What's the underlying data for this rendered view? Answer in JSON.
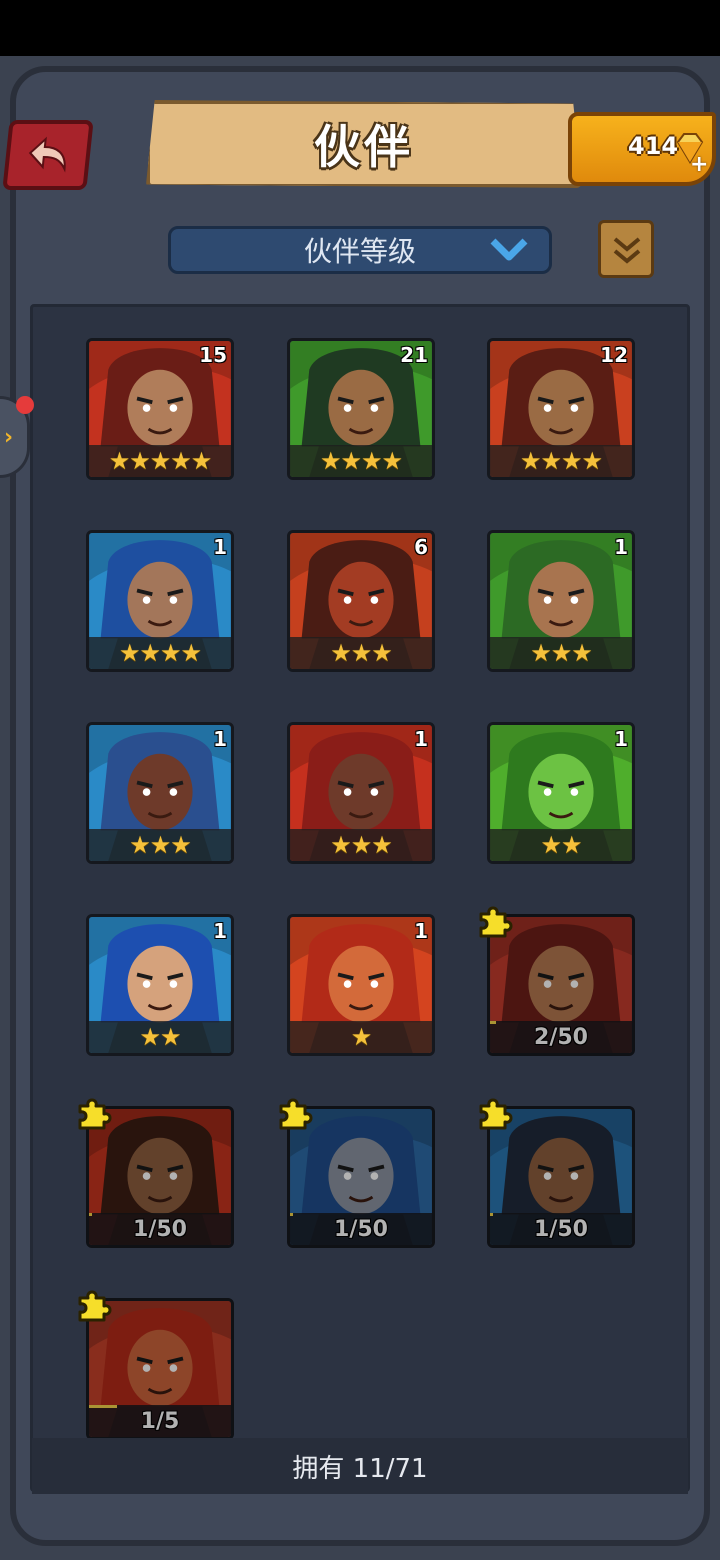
{
  "header": {
    "title": "伙伴",
    "gems": "414"
  },
  "filter": {
    "label": "伙伴等级"
  },
  "partners": [
    {
      "count": "15",
      "stars": "★★★★★",
      "bg": "#c3321f",
      "face": "#b07d5a",
      "hair": "#6a1d16"
    },
    {
      "count": "21",
      "stars": "★★★★",
      "bg": "#3f9a2b",
      "face": "#9a6b44",
      "hair": "#1f3a22"
    },
    {
      "count": "12",
      "stars": "★★★★",
      "bg": "#c9401f",
      "face": "#9a6b44",
      "hair": "#5a1d14"
    },
    {
      "count": "1",
      "stars": "★★★★",
      "bg": "#2a8ac7",
      "face": "#a3765a",
      "hair": "#1e4fa0"
    },
    {
      "count": "6",
      "stars": "★★★",
      "bg": "#c5401e",
      "face": "#a33c23",
      "hair": "#4a1c14"
    },
    {
      "count": "1",
      "stars": "★★★",
      "bg": "#3f9a2b",
      "face": "#a8744f",
      "hair": "#2c6a24"
    },
    {
      "count": "1",
      "stars": "★★★",
      "bg": "#2a8ac7",
      "face": "#6e3a2a",
      "hair": "#2a4f8f"
    },
    {
      "count": "1",
      "stars": "★★★",
      "bg": "#c5301e",
      "face": "#6e3a2a",
      "hair": "#8a1d18"
    },
    {
      "count": "1",
      "stars": "★★",
      "bg": "#4fae2c",
      "face": "#6cc243",
      "hair": "#2e7a1e"
    },
    {
      "count": "1",
      "stars": "★★",
      "bg": "#2a8ac7",
      "face": "#d5a27c",
      "hair": "#1d4fb0"
    },
    {
      "count": "1",
      "stars": "★",
      "bg": "#d4441f",
      "face": "#d36a3a",
      "hair": "#b22a18"
    }
  ],
  "fragments": [
    {
      "progress": "2/50",
      "fill": 0.04,
      "bg": "#c13a2c",
      "face": "#b2774f",
      "hair": "#6d1e18"
    },
    {
      "progress": "1/50",
      "fill": 0.02,
      "bg": "#c4331e",
      "face": "#8c5d3d",
      "hair": "#3a1c12"
    },
    {
      "progress": "1/50",
      "fill": 0.02,
      "bg": "#2c6aa5",
      "face": "#8a92a0",
      "hair": "#1f4c8a"
    },
    {
      "progress": "1/50",
      "fill": 0.02,
      "bg": "#2a75b0",
      "face": "#8c5d3d",
      "hair": "#1f2a3a"
    },
    {
      "progress": "1/5",
      "fill": 0.2,
      "bg": "#c4402a",
      "face": "#c9623a",
      "hair": "#b22a18"
    }
  ],
  "footer": {
    "owned": "拥有 11/71"
  }
}
